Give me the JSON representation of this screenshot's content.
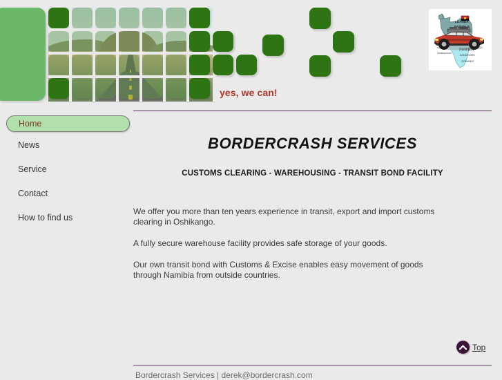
{
  "header": {
    "slogan": "yes, we can!",
    "logo": {
      "name": "angola-namibia-map-with-car-logo",
      "alt": "Map of Angola and Namibia with a red car",
      "labels": [
        "ANGOLA",
        "NAMIBIA"
      ],
      "colors": {
        "angola": "#7fa8a8",
        "namibia": "#aee8f0",
        "car": "#c0392b"
      }
    },
    "mosaic": {
      "photo_alt": "Desert road through Namibia",
      "tile_color": "#2e7412",
      "panel_color": "#6bb86b",
      "rows": 4,
      "cols": 7
    }
  },
  "sidebar": {
    "items": [
      {
        "label": "Home",
        "active": true
      },
      {
        "label": "News",
        "active": false
      },
      {
        "label": "Service",
        "active": false
      },
      {
        "label": "Contact",
        "active": false
      },
      {
        "label": "How to find us",
        "active": false
      }
    ]
  },
  "main": {
    "title": "BORDERCRASH SERVICES",
    "subtitle": "CUSTOMS CLEARING  -  WAREHOUSING  -  TRANSIT BOND FACILITY",
    "paragraphs": [
      "We offer you more than ten years experience in transit, export and import customs clearing in Oshikango.",
      "A fully secure warehouse facility provides safe storage of your goods.",
      "Our own transit bond with Customs & Excise enables easy movement of goods through Namibia from outside countries."
    ],
    "top_link_label": "Top",
    "footer": "Bordercrash Services | derek@bordercrash.com"
  },
  "colors": {
    "page_background": "#eaeaea",
    "accent_green": "#2e7412",
    "panel_green": "#6bb86b",
    "active_nav_green": "#b2e0ac",
    "rule_purple": "#4c2a4c",
    "slogan_red": "#b03527",
    "top_button": "#3b1438"
  }
}
